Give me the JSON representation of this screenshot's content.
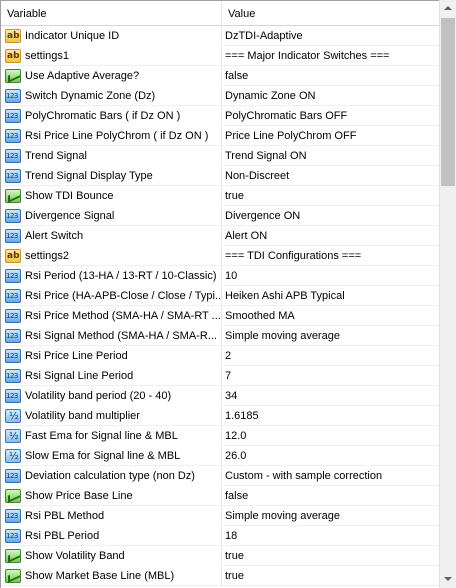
{
  "header": {
    "col_variable": "Variable",
    "col_value": "Value"
  },
  "rows": [
    {
      "icon": "ab-icon",
      "name": "Indicator Unique ID",
      "value": "DzTDI-Adaptive"
    },
    {
      "icon": "ab-icon",
      "name": "settings1",
      "value": "=== Major Indicator Switches ==="
    },
    {
      "icon": "bool-icon",
      "name": "Use Adaptive Average?",
      "value": "false"
    },
    {
      "icon": "int-icon",
      "name": "Switch Dynamic Zone (Dz)",
      "value": "Dynamic Zone ON"
    },
    {
      "icon": "int-icon",
      "name": "PolyChromatic Bars ( if Dz ON )",
      "value": "PolyChromatic Bars OFF"
    },
    {
      "icon": "int-icon",
      "name": "Rsi Price Line PolyChrom ( if Dz ON )",
      "value": "Price Line PolyChrom OFF"
    },
    {
      "icon": "int-icon",
      "name": "Trend Signal",
      "value": "Trend Signal ON"
    },
    {
      "icon": "int-icon",
      "name": "Trend Signal Display Type",
      "value": "Non-Discreet"
    },
    {
      "icon": "bool-icon",
      "name": "Show TDI Bounce",
      "value": "true"
    },
    {
      "icon": "int-icon",
      "name": "Divergence Signal",
      "value": "Divergence ON"
    },
    {
      "icon": "int-icon",
      "name": "Alert Switch",
      "value": "Alert ON"
    },
    {
      "icon": "ab-icon",
      "name": "settings2",
      "value": "=== TDI Configurations ==="
    },
    {
      "icon": "int-icon",
      "name": "Rsi Period (13-HA / 13-RT / 10-Classic)",
      "value": "10"
    },
    {
      "icon": "int-icon",
      "name": "Rsi Price (HA-APB-Close / Close / Typi...",
      "value": "Heiken Ashi APB Typical"
    },
    {
      "icon": "int-icon",
      "name": "Rsi Price Method (SMA-HA / SMA-RT ...",
      "value": "Smoothed MA"
    },
    {
      "icon": "int-icon",
      "name": "Rsi Signal Method (SMA-HA / SMA-R...",
      "value": "Simple moving average"
    },
    {
      "icon": "int-icon",
      "name": "Rsi Price Line Period",
      "value": "2"
    },
    {
      "icon": "int-icon",
      "name": "Rsi Signal Line Period",
      "value": "7"
    },
    {
      "icon": "int-icon",
      "name": "Volatility band period (20 - 40)",
      "value": "34"
    },
    {
      "icon": "double-icon",
      "name": "Volatility band multiplier",
      "value": "1.6185"
    },
    {
      "icon": "double-icon",
      "name": "Fast Ema for Signal line & MBL",
      "value": "12.0"
    },
    {
      "icon": "double-icon",
      "name": "Slow Ema for Signal line & MBL",
      "value": "26.0"
    },
    {
      "icon": "int-icon",
      "name": "Deviation calculation type (non Dz)",
      "value": "Custom - with sample correction"
    },
    {
      "icon": "bool-icon",
      "name": "Show Price Base Line",
      "value": "false"
    },
    {
      "icon": "int-icon",
      "name": "Rsi PBL Method",
      "value": "Simple moving average"
    },
    {
      "icon": "int-icon",
      "name": "Rsi PBL Period",
      "value": "18"
    },
    {
      "icon": "bool-icon",
      "name": "Show Volatility Band",
      "value": "true"
    },
    {
      "icon": "bool-icon",
      "name": "Show Market Base Line (MBL)",
      "value": "true"
    }
  ]
}
